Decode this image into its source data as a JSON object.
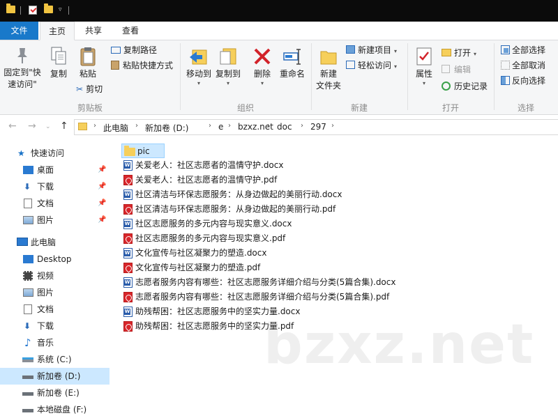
{
  "tabs": {
    "file": "文件",
    "home": "主页",
    "share": "共享",
    "view": "查看"
  },
  "ribbon": {
    "clipboard": {
      "pin_quick_access": "固定到\"快速访问\"",
      "copy": "复制",
      "paste": "粘贴",
      "copy_path": "复制路径",
      "paste_shortcut": "粘贴快捷方式",
      "cut": "剪切",
      "label": "剪贴板"
    },
    "organize": {
      "move_to": "移动到",
      "copy_to": "复制到",
      "delete": "删除",
      "rename": "重命名",
      "label": "组织"
    },
    "new": {
      "new_folder": "新建\n文件夹",
      "new_item": "新建项目",
      "easy_access": "轻松访问",
      "label": "新建"
    },
    "open": {
      "properties": "属性",
      "open": "打开",
      "edit": "编辑",
      "history": "历史记录",
      "label": "打开"
    },
    "select": {
      "select_all": "全部选择",
      "select_none": "全部取消",
      "invert": "反向选择",
      "label": "选择"
    }
  },
  "breadcrumb": [
    "此电脑",
    "新加卷 (D:)",
    "e",
    "bzxz.net",
    "doc",
    "297"
  ],
  "nav_pane": {
    "quick_access": "快速访问",
    "quick_items": [
      "桌面",
      "下载",
      "文档",
      "图片"
    ],
    "this_pc": "此电脑",
    "pc_items": [
      "Desktop",
      "视频",
      "图片",
      "文档",
      "下载",
      "音乐",
      "系统 (C:)",
      "新加卷 (D:)",
      "新加卷 (E:)",
      "本地磁盘 (F:)"
    ]
  },
  "files": [
    {
      "name": "pic",
      "type": "folder"
    },
    {
      "name": "关爱老人：社区志愿者的温情守护.docx",
      "type": "docx"
    },
    {
      "name": "关爱老人：社区志愿者的温情守护.pdf",
      "type": "pdf"
    },
    {
      "name": "社区清洁与环保志愿服务：从身边做起的美丽行动.docx",
      "type": "docx"
    },
    {
      "name": "社区清洁与环保志愿服务：从身边做起的美丽行动.pdf",
      "type": "pdf"
    },
    {
      "name": "社区志愿服务的多元内容与现实意义.docx",
      "type": "docx"
    },
    {
      "name": "社区志愿服务的多元内容与现实意义.pdf",
      "type": "pdf"
    },
    {
      "name": "文化宣传与社区凝聚力的塑造.docx",
      "type": "docx"
    },
    {
      "name": "文化宣传与社区凝聚力的塑造.pdf",
      "type": "pdf"
    },
    {
      "name": "志愿者服务内容有哪些：社区志愿服务详细介绍与分类(5篇合集).docx",
      "type": "docx"
    },
    {
      "name": "志愿者服务内容有哪些：社区志愿服务详细介绍与分类(5篇合集).pdf",
      "type": "pdf"
    },
    {
      "name": "助残帮困：社区志愿服务中的坚实力量.docx",
      "type": "docx"
    },
    {
      "name": "助残帮困：社区志愿服务中的坚实力量.pdf",
      "type": "pdf"
    }
  ],
  "watermark": "bzxz.net"
}
